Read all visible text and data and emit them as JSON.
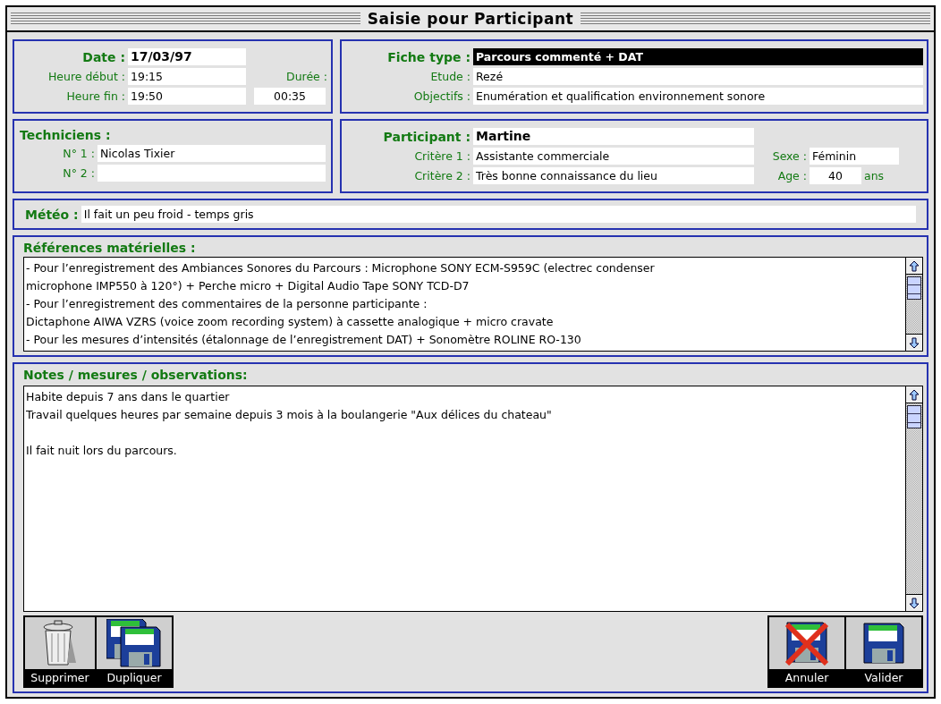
{
  "window": {
    "title": "Saisie pour Participant"
  },
  "session": {
    "date": {
      "label": "Date :",
      "value": "17/03/97"
    },
    "start": {
      "label": "Heure début :",
      "value": "19:15"
    },
    "end": {
      "label": "Heure fin :",
      "value": "19:50"
    },
    "duration": {
      "label": "Durée :",
      "value": "00:35"
    }
  },
  "study": {
    "sheet_type": {
      "label": "Fiche type :",
      "value": "Parcours commenté + DAT",
      "highlighted": true
    },
    "study": {
      "label": "Etude :",
      "value": "Rezé"
    },
    "objectives": {
      "label": "Objectifs :",
      "value": "Enumération et qualification environnement sonore"
    }
  },
  "technicians": {
    "title": "Techniciens :",
    "items": [
      {
        "label": "N° 1 :",
        "value": "Nicolas Tixier"
      },
      {
        "label": "N° 2 :"
      }
    ]
  },
  "participant": {
    "name": {
      "label": "Participant :",
      "value": "Martine"
    },
    "criteria": [
      {
        "label": "Critère 1 :",
        "value": "Assistante commerciale"
      },
      {
        "label": "Critère 2 :",
        "value": "Très bonne connaissance du lieu"
      }
    ],
    "sex": {
      "label": "Sexe :",
      "value": "Féminin"
    },
    "age": {
      "label": "Age :",
      "value": "40",
      "unit": "ans"
    }
  },
  "weather": {
    "label": "Météo :",
    "value": "Il fait un peu froid - temps gris"
  },
  "equipment": {
    "title": "Références matérielles :",
    "lines": [
      "- Pour l’enregistrement des Ambiances Sonores du Parcours : Microphone SONY ECM-S959C  (electrec condenser",
      "microphone IMP550 à 120°) + Perche micro +  Digital Audio Tape SONY TCD-D7",
      "- Pour l’enregistrement des commentaires de la personne participante :",
      "Dictaphone AIWA VZRS (voice zoom recording system) à cassette analogique + micro cravate",
      "- Pour les mesures d’intensités (étalonnage de l’enregistrement DAT) + Sonomètre ROLINE RO-130"
    ]
  },
  "notes": {
    "title": "Notes / mesures / observations:",
    "paragraphs": [
      [
        "Habite depuis 7 ans dans le quartier",
        "Travail quelques heures par semaine depuis 3 mois à la boulangerie \"Aux délices du chateau\""
      ],
      [
        "Il fait nuit lors du parcours."
      ]
    ]
  },
  "action_groups": [
    {
      "buttons": [
        {
          "label": "Supprimer",
          "kind": "delete"
        },
        {
          "label": "Dupliquer",
          "kind": "duplicate"
        }
      ]
    },
    {
      "buttons": [
        {
          "label": "Annuler",
          "kind": "cancel"
        },
        {
          "label": "Valider",
          "kind": "validate"
        }
      ]
    }
  ]
}
